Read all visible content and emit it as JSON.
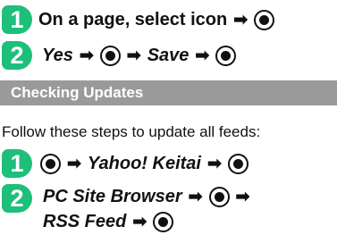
{
  "steps_top": [
    {
      "number": "1",
      "text": "On a page, select icon"
    },
    {
      "number": "2",
      "yes": "Yes",
      "save": "Save"
    }
  ],
  "section": {
    "title": "Checking Updates",
    "intro": "Follow these steps to update all feeds:"
  },
  "steps_bottom": [
    {
      "number": "1",
      "target": "Yahoo! Keitai"
    },
    {
      "number": "2",
      "line1": "PC Site Browser",
      "line2": "RSS Feed"
    }
  ],
  "icons": {
    "arrow": "➡",
    "center_key": "center-select-key"
  },
  "colors": {
    "badge": "#1dbf7a",
    "section_bar": "#9a9a9a"
  }
}
